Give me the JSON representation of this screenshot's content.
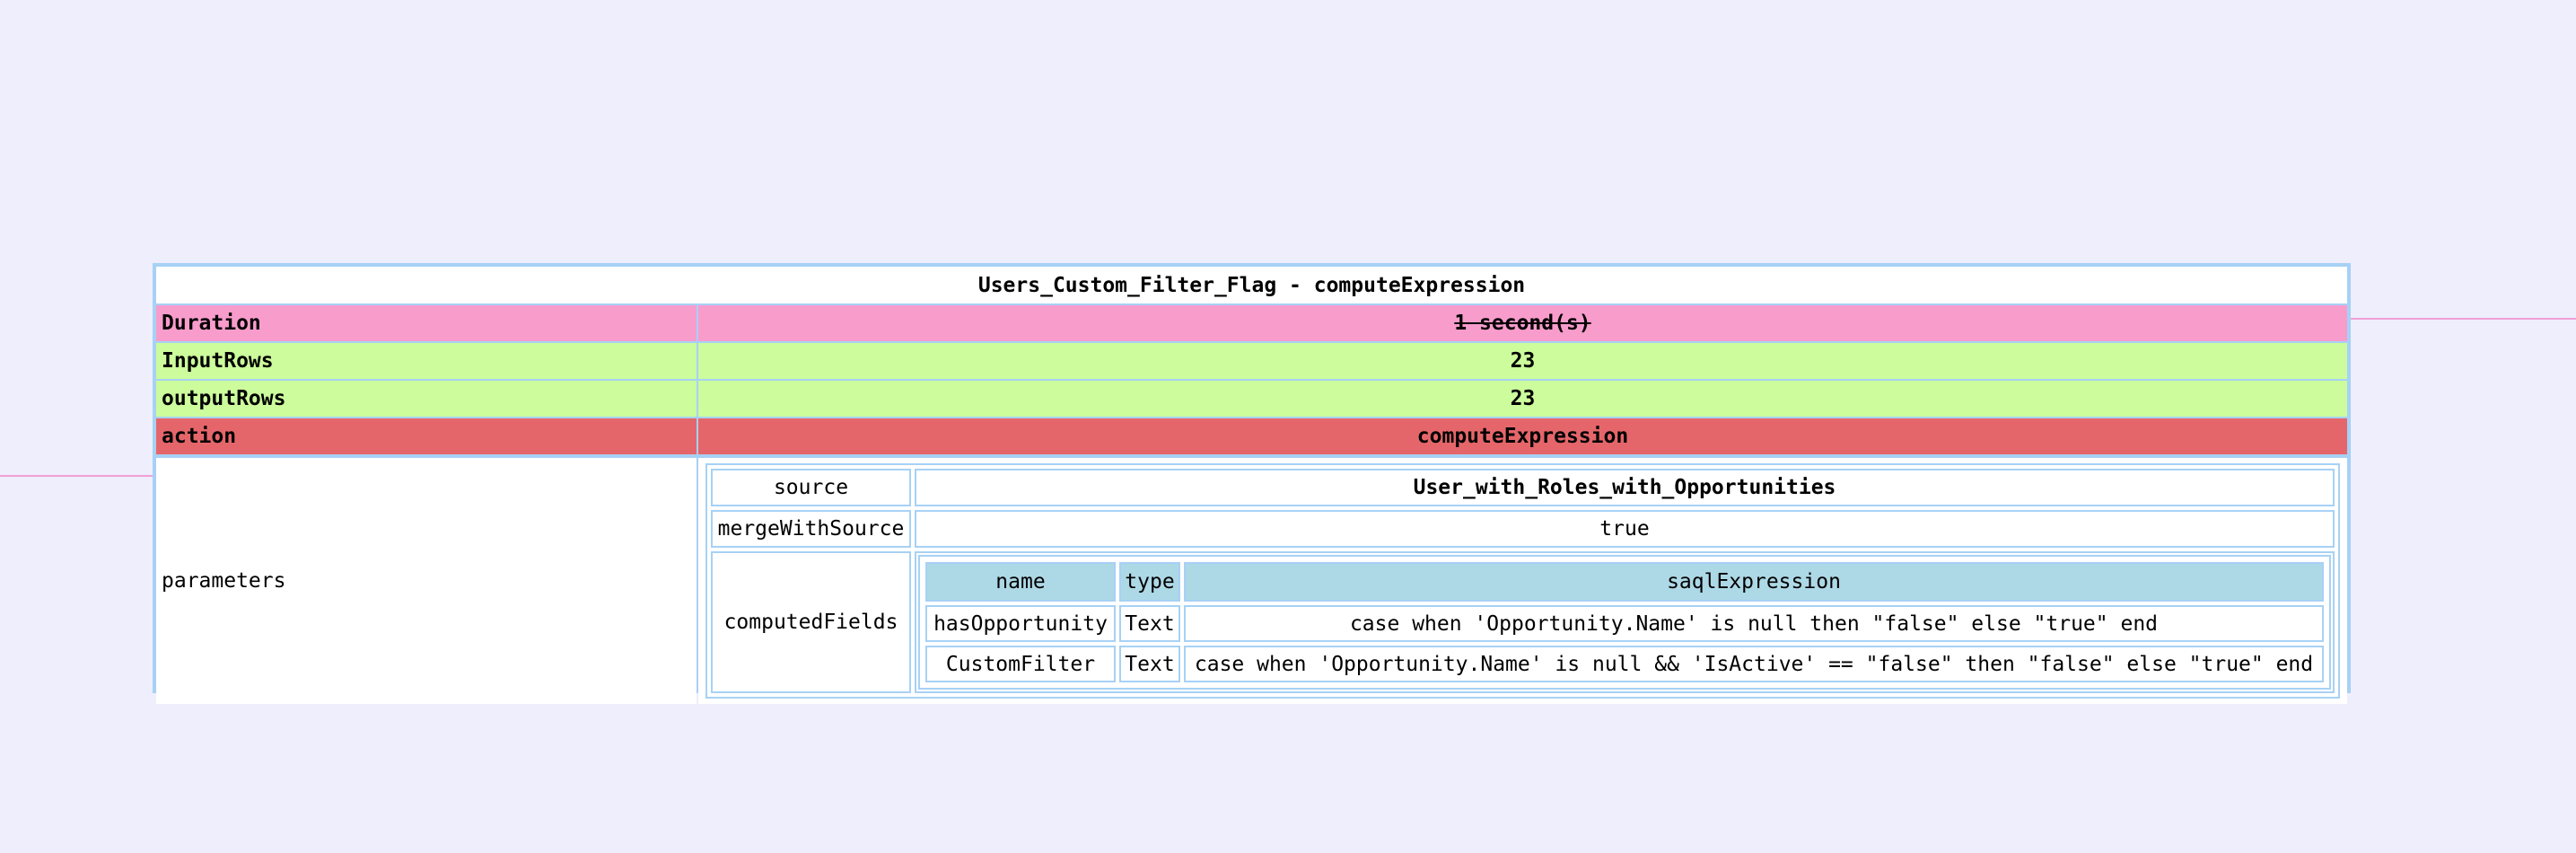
{
  "node": {
    "title": "Users_Custom_Filter_Flag - computeExpression",
    "rows": {
      "duration": {
        "key": "Duration",
        "value": "1 second(s)"
      },
      "input_rows": {
        "key": "InputRows",
        "value": "23"
      },
      "output_rows": {
        "key": "outputRows",
        "value": "23"
      },
      "action": {
        "key": "action",
        "value": "computeExpression"
      }
    },
    "parameters": {
      "key": "parameters",
      "source": {
        "key": "source",
        "value": "User_with_Roles_with_Opportunities"
      },
      "merge_with_source": {
        "key": "mergeWithSource",
        "value": "true"
      },
      "computed_fields": {
        "key": "computedFields",
        "headers": [
          "name",
          "type",
          "saqlExpression"
        ],
        "rows": [
          [
            "hasOpportunity",
            "Text",
            "case when 'Opportunity.Name' is null then \"false\" else \"true\" end"
          ],
          [
            "CustomFilter",
            "Text",
            "case when 'Opportunity.Name' is null && 'IsActive' == \"false\" then \"false\" else \"true\" end"
          ]
        ]
      }
    }
  },
  "colors": {
    "background": "#eeeefc",
    "border": "#a7d1f5",
    "duration_row": "#f89ccc",
    "rows_row": "#ccfc9c",
    "action_row": "#e5666a",
    "header_cell": "#add8e6",
    "edge": "#f0a0d8"
  }
}
